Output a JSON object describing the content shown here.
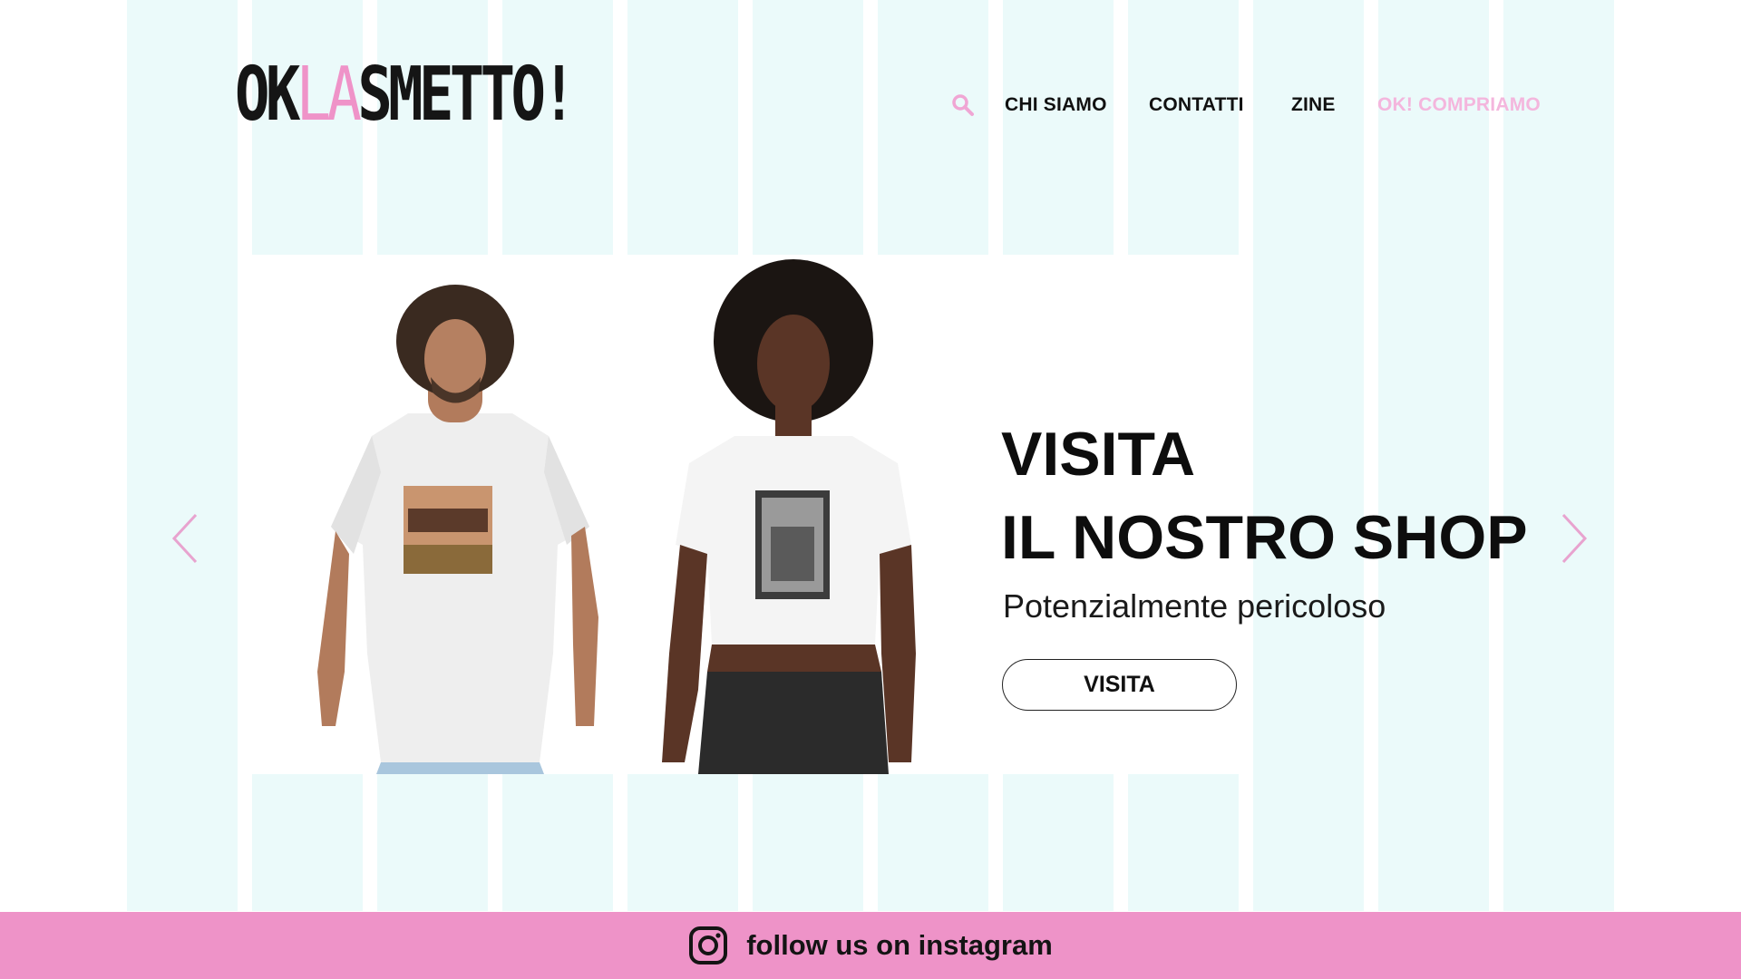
{
  "brand": {
    "logo_part1": "OK",
    "logo_part2": "LA",
    "logo_part3": "SMETTO!",
    "accent_color": "#ef93c8"
  },
  "nav": {
    "search_icon": "search-icon",
    "items": [
      {
        "label": "CHI SIAMO"
      },
      {
        "label": "CONTATTI"
      },
      {
        "label": "ZINE"
      },
      {
        "label": "OK! COMPRIAMO"
      }
    ]
  },
  "hero": {
    "title_line1": "VISITA",
    "title_line2": "IL NOSTRO SHOP",
    "subtitle": "Potenzialmente pericoloso",
    "button_label": "VISITA",
    "prev_icon": "chevron-left-icon",
    "next_icon": "chevron-right-icon"
  },
  "footer": {
    "icon": "instagram-icon",
    "text": "follow us on instagram",
    "bg_color": "#ee93c8"
  }
}
